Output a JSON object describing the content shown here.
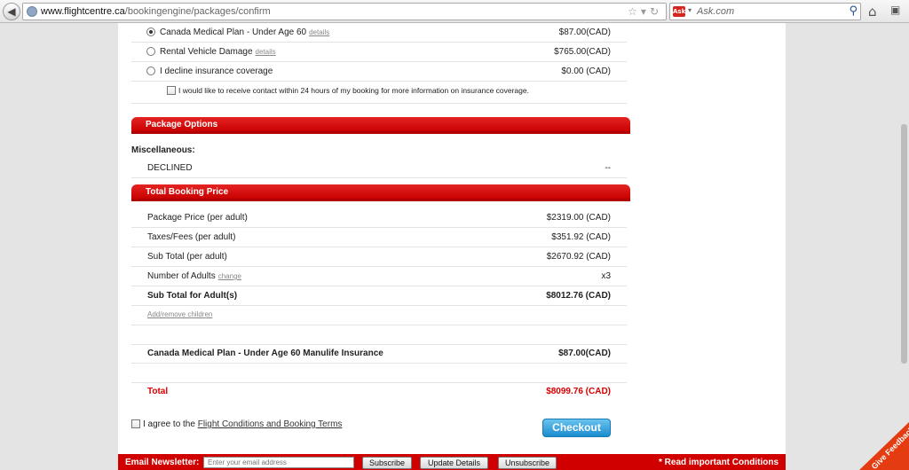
{
  "browser": {
    "url_host": "www.flightcentre.ca",
    "url_path": "/bookingengine/packages/confirm",
    "search_placeholder": "Ask.com",
    "search_logo": "Ask"
  },
  "insurance": {
    "options": [
      {
        "label": "Canada Medical Plan - Under Age 60",
        "link": "details",
        "price": "$87.00(CAD)",
        "selected": true
      },
      {
        "label": "Rental Vehicle Damage",
        "link": "details",
        "price": "$765.00(CAD)",
        "selected": false
      },
      {
        "label": "I decline insurance coverage",
        "price": "$0.00 (CAD)",
        "selected": false
      }
    ],
    "contact_text": "I would like to receive contact within 24 hours of my booking for more information on insurance coverage."
  },
  "package_options": {
    "title": "Package Options",
    "misc_label": "Miscellaneous:",
    "declined_label": "DECLINED",
    "declined_value": "--"
  },
  "total_booking": {
    "title": "Total Booking Price",
    "package_price_label": "Package Price (per adult)",
    "package_price": "$2319.00 (CAD)",
    "taxes_label": "Taxes/Fees (per adult)",
    "taxes": "$351.92 (CAD)",
    "subtotal_label": "Sub Total (per adult)",
    "subtotal": "$2670.92 (CAD)",
    "adults_label": "Number of Adults",
    "adults_link": "change",
    "adults_value": "x3",
    "subtotal_adults_label": "Sub Total for Adult(s)",
    "subtotal_adults": "$8012.76 (CAD)",
    "add_children": "Add/remove children",
    "insurance_label": "Canada Medical Plan - Under Age 60 Manulife Insurance",
    "insurance_value": "$87.00(CAD)",
    "total_label": "Total",
    "total_value": "$8099.76 (CAD)"
  },
  "agree": {
    "prefix": "I agree to the ",
    "link": "Flight Conditions and Booking Terms"
  },
  "checkout_label": "Checkout",
  "newsletter": {
    "label": "Email Newsletter:",
    "placeholder": "Enter your email address",
    "subscribe": "Subscribe",
    "update": "Update Details",
    "unsubscribe": "Unsubscribe",
    "conditions": "* Read important Conditions"
  },
  "feedback_label": "Give Feedback",
  "colors": {
    "brand_red": "#d60000",
    "checkout_blue": "#1a8ccf"
  }
}
